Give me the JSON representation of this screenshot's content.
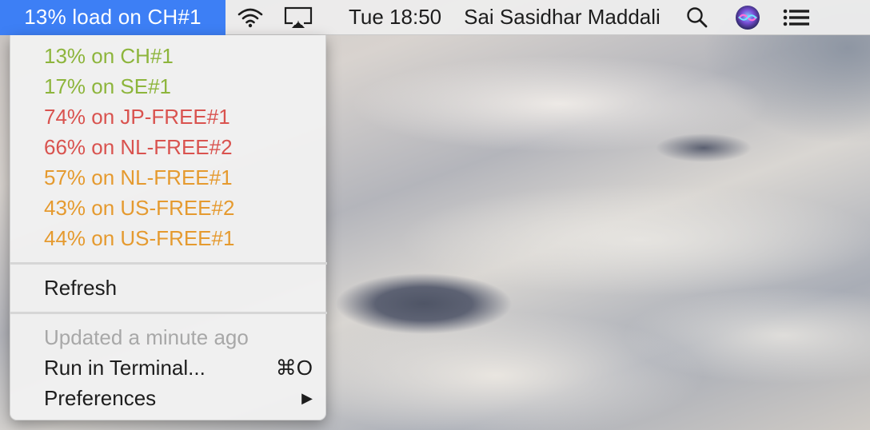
{
  "menubar": {
    "status_item": "13% load on CH#1",
    "datetime": "Tue 18:50",
    "user": "Sai Sasidhar Maddali",
    "icons": [
      "wifi-icon",
      "airplay-icon",
      "spotlight-search-icon",
      "siri-icon",
      "notification-center-icon"
    ]
  },
  "menu": {
    "servers": [
      {
        "label": "13% on CH#1",
        "color": "#8db53c"
      },
      {
        "label": "17% on SE#1",
        "color": "#8db53c"
      },
      {
        "label": "74% on JP-FREE#1",
        "color": "#d9534f"
      },
      {
        "label": "66% on NL-FREE#2",
        "color": "#d9534f"
      },
      {
        "label": "57% on NL-FREE#1",
        "color": "#e59a2f"
      },
      {
        "label": "43% on US-FREE#2",
        "color": "#e59a2f"
      },
      {
        "label": "44% on US-FREE#1",
        "color": "#e59a2f"
      }
    ],
    "refresh": "Refresh",
    "updated": "Updated a minute ago",
    "run_in_terminal": "Run in Terminal...",
    "run_shortcut": "⌘O",
    "preferences": "Preferences",
    "preferences_arrow": "▶"
  },
  "colors": {
    "accent": "#3d7ff5",
    "low_load": "#8db53c",
    "high_load": "#d9534f",
    "mid_load": "#e59a2f",
    "disabled_text": "#a8a8a8"
  }
}
